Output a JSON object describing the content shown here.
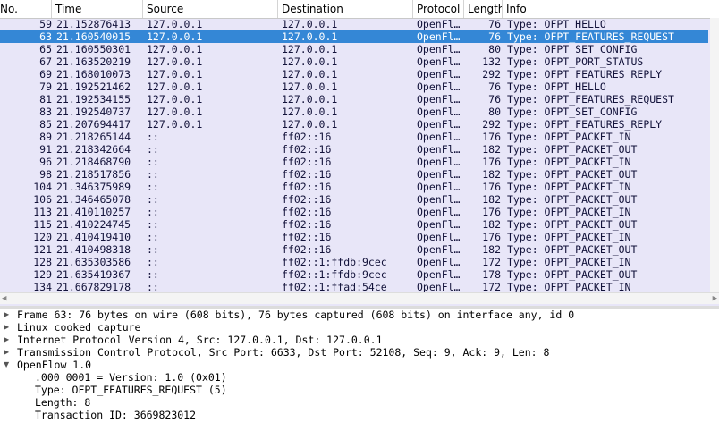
{
  "columns": {
    "no": "No.",
    "time": "Time",
    "source": "Source",
    "destination": "Destination",
    "protocol": "Protocol",
    "length": "Length",
    "info": "Info"
  },
  "packets": [
    {
      "no": "59",
      "time": "21.152876413",
      "src": "127.0.0.1",
      "dst": "127.0.0.1",
      "proto": "OpenFl…",
      "len": "76",
      "info": "Type: OFPT_HELLO",
      "selected": false
    },
    {
      "no": "63",
      "time": "21.160540015",
      "src": "127.0.0.1",
      "dst": "127.0.0.1",
      "proto": "OpenFl…",
      "len": "76",
      "info": "Type: OFPT_FEATURES_REQUEST",
      "selected": true
    },
    {
      "no": "65",
      "time": "21.160550301",
      "src": "127.0.0.1",
      "dst": "127.0.0.1",
      "proto": "OpenFl…",
      "len": "80",
      "info": "Type: OFPT_SET_CONFIG",
      "selected": false
    },
    {
      "no": "67",
      "time": "21.163520219",
      "src": "127.0.0.1",
      "dst": "127.0.0.1",
      "proto": "OpenFl…",
      "len": "132",
      "info": "Type: OFPT_PORT_STATUS",
      "selected": false
    },
    {
      "no": "69",
      "time": "21.168010073",
      "src": "127.0.0.1",
      "dst": "127.0.0.1",
      "proto": "OpenFl…",
      "len": "292",
      "info": "Type: OFPT_FEATURES_REPLY",
      "selected": false
    },
    {
      "no": "79",
      "time": "21.192521462",
      "src": "127.0.0.1",
      "dst": "127.0.0.1",
      "proto": "OpenFl…",
      "len": "76",
      "info": "Type: OFPT_HELLO",
      "selected": false
    },
    {
      "no": "81",
      "time": "21.192534155",
      "src": "127.0.0.1",
      "dst": "127.0.0.1",
      "proto": "OpenFl…",
      "len": "76",
      "info": "Type: OFPT_FEATURES_REQUEST",
      "selected": false
    },
    {
      "no": "83",
      "time": "21.192540737",
      "src": "127.0.0.1",
      "dst": "127.0.0.1",
      "proto": "OpenFl…",
      "len": "80",
      "info": "Type: OFPT_SET_CONFIG",
      "selected": false
    },
    {
      "no": "85",
      "time": "21.207694417",
      "src": "127.0.0.1",
      "dst": "127.0.0.1",
      "proto": "OpenFl…",
      "len": "292",
      "info": "Type: OFPT_FEATURES_REPLY",
      "selected": false
    },
    {
      "no": "89",
      "time": "21.218265144",
      "src": "::",
      "dst": "ff02::16",
      "proto": "OpenFl…",
      "len": "176",
      "info": "Type: OFPT_PACKET_IN",
      "selected": false
    },
    {
      "no": "91",
      "time": "21.218342664",
      "src": "::",
      "dst": "ff02::16",
      "proto": "OpenFl…",
      "len": "182",
      "info": "Type: OFPT_PACKET_OUT",
      "selected": false
    },
    {
      "no": "96",
      "time": "21.218468790",
      "src": "::",
      "dst": "ff02::16",
      "proto": "OpenFl…",
      "len": "176",
      "info": "Type: OFPT_PACKET_IN",
      "selected": false
    },
    {
      "no": "98",
      "time": "21.218517856",
      "src": "::",
      "dst": "ff02::16",
      "proto": "OpenFl…",
      "len": "182",
      "info": "Type: OFPT_PACKET_OUT",
      "selected": false
    },
    {
      "no": "104",
      "time": "21.346375989",
      "src": "::",
      "dst": "ff02::16",
      "proto": "OpenFl…",
      "len": "176",
      "info": "Type: OFPT_PACKET_IN",
      "selected": false
    },
    {
      "no": "106",
      "time": "21.346465078",
      "src": "::",
      "dst": "ff02::16",
      "proto": "OpenFl…",
      "len": "182",
      "info": "Type: OFPT_PACKET_OUT",
      "selected": false
    },
    {
      "no": "113",
      "time": "21.410110257",
      "src": "::",
      "dst": "ff02::16",
      "proto": "OpenFl…",
      "len": "176",
      "info": "Type: OFPT_PACKET_IN",
      "selected": false
    },
    {
      "no": "115",
      "time": "21.410224745",
      "src": "::",
      "dst": "ff02::16",
      "proto": "OpenFl…",
      "len": "182",
      "info": "Type: OFPT_PACKET_OUT",
      "selected": false
    },
    {
      "no": "120",
      "time": "21.410419410",
      "src": "::",
      "dst": "ff02::16",
      "proto": "OpenFl…",
      "len": "176",
      "info": "Type: OFPT_PACKET_IN",
      "selected": false
    },
    {
      "no": "121",
      "time": "21.410498318",
      "src": "::",
      "dst": "ff02::16",
      "proto": "OpenFl…",
      "len": "182",
      "info": "Type: OFPT_PACKET_OUT",
      "selected": false
    },
    {
      "no": "128",
      "time": "21.635303586",
      "src": "::",
      "dst": "ff02::1:ffdb:9cec",
      "proto": "OpenFl…",
      "len": "172",
      "info": "Type: OFPT_PACKET_IN",
      "selected": false
    },
    {
      "no": "129",
      "time": "21.635419367",
      "src": "::",
      "dst": "ff02::1:ffdb:9cec",
      "proto": "OpenFl…",
      "len": "178",
      "info": "Type: OFPT_PACKET_OUT",
      "selected": false
    },
    {
      "no": "134",
      "time": "21.667829178",
      "src": "::",
      "dst": "ff02::1:ffad:54ce",
      "proto": "OpenFl…",
      "len": "172",
      "info": "Type: OFPT_PACKET_IN",
      "selected": false
    }
  ],
  "details": [
    {
      "text": "Frame 63: 76 bytes on wire (608 bits), 76 bytes captured (608 bits) on interface any, id 0",
      "expanded": false,
      "child": false
    },
    {
      "text": "Linux cooked capture",
      "expanded": false,
      "child": false
    },
    {
      "text": "Internet Protocol Version 4, Src: 127.0.0.1, Dst: 127.0.0.1",
      "expanded": false,
      "child": false
    },
    {
      "text": "Transmission Control Protocol, Src Port: 6633, Dst Port: 52108, Seq: 9, Ack: 9, Len: 8",
      "expanded": false,
      "child": false
    },
    {
      "text": "OpenFlow 1.0",
      "expanded": true,
      "child": false
    },
    {
      "text": ".000 0001 = Version: 1.0 (0x01)",
      "expanded": null,
      "child": true
    },
    {
      "text": "Type: OFPT_FEATURES_REQUEST (5)",
      "expanded": null,
      "child": true
    },
    {
      "text": "Length: 8",
      "expanded": null,
      "child": true
    },
    {
      "text": "Transaction ID: 3669823012",
      "expanded": null,
      "child": true
    }
  ],
  "colors": {
    "row_bg": "#e8e6f8",
    "selected_bg": "#3487d6",
    "selected_text": "#ffffff"
  }
}
